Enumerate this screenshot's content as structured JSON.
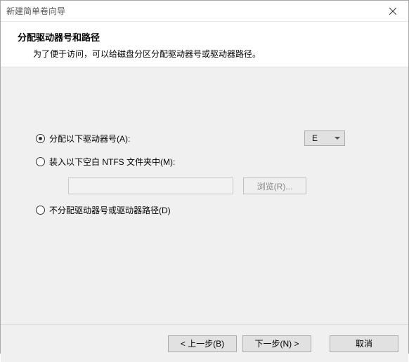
{
  "window": {
    "title": "新建简单卷向导"
  },
  "header": {
    "title": "分配驱动器号和路径",
    "description": "为了便于访问，可以给磁盘分区分配驱动器号或驱动器路径。"
  },
  "options": {
    "assign": {
      "label": "分配以下驱动器号(A):",
      "checked": true,
      "drive_value": "E"
    },
    "mount": {
      "label": "装入以下空白 NTFS 文件夹中(M):",
      "checked": false,
      "path_value": "",
      "browse_label": "浏览(R)..."
    },
    "none": {
      "label": "不分配驱动器号或驱动器路径(D)",
      "checked": false
    }
  },
  "footer": {
    "back": "< 上一步(B)",
    "next": "下一步(N) >",
    "cancel": "取消"
  }
}
